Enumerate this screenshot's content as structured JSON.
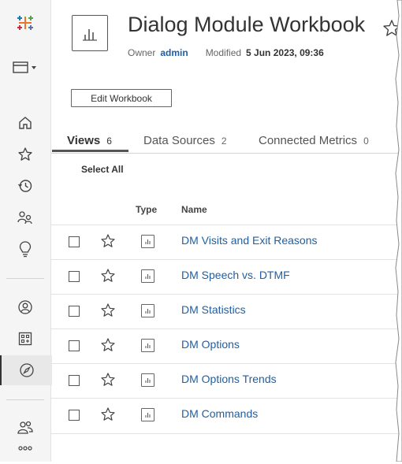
{
  "workbook": {
    "title": "Dialog Module Workbook",
    "owner_label": "Owner",
    "owner_name": "admin",
    "modified_label": "Modified",
    "modified_value": "5 Jun 2023, 09:36",
    "edit_button": "Edit Workbook"
  },
  "tabs": [
    {
      "label": "Views",
      "count": "6"
    },
    {
      "label": "Data Sources",
      "count": "2"
    },
    {
      "label": "Connected Metrics",
      "count": "0"
    }
  ],
  "select_all": "Select All",
  "columns": {
    "type": "Type",
    "name": "Name"
  },
  "views": [
    {
      "name": "DM Visits and Exit Reasons"
    },
    {
      "name": "DM Speech vs. DTMF"
    },
    {
      "name": "DM Statistics"
    },
    {
      "name": "DM Options"
    },
    {
      "name": "DM Options Trends"
    },
    {
      "name": "DM Commands"
    }
  ],
  "sidebar": {
    "items": [
      "tableau-logo-icon",
      "site-switcher-icon",
      "home-icon",
      "favorites-icon",
      "recents-icon",
      "shared-with-me-icon",
      "recommendations-icon",
      "personal-space-icon",
      "collections-icon",
      "explore-icon",
      "users-icon",
      "more-icon"
    ]
  },
  "colors": {
    "link": "#1f5fa3",
    "sidebar_bg": "#f5f5f5"
  }
}
